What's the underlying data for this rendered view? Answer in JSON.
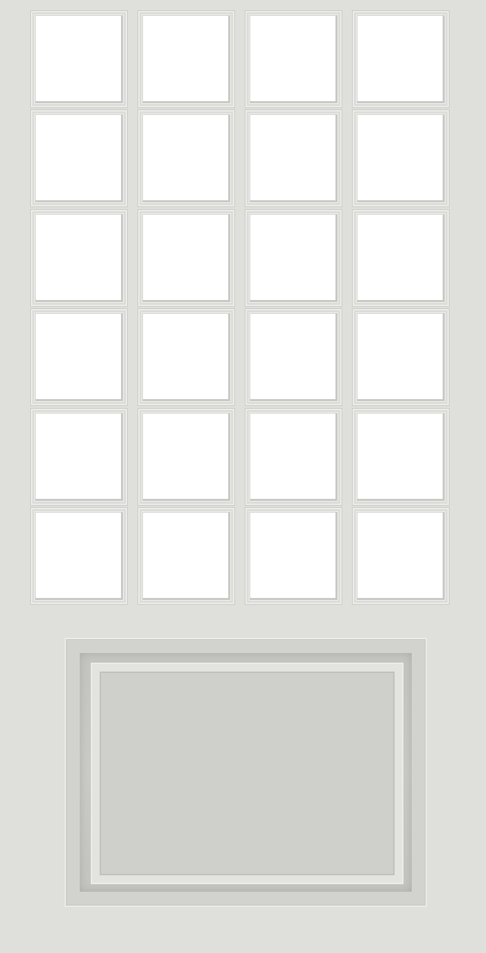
{
  "door": {
    "lite_rows": 6,
    "lite_columns": 4,
    "colors": {
      "door_surface": "#dfe0dc",
      "glass": "#ffffff",
      "raised_panel": "#cfd0cb"
    }
  }
}
